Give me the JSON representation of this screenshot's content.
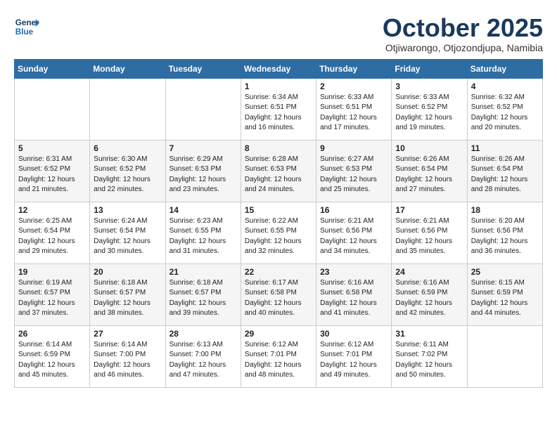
{
  "header": {
    "logo_line1": "General",
    "logo_line2": "Blue",
    "month": "October 2025",
    "location": "Otjiwarongo, Otjozondjupa, Namibia"
  },
  "weekdays": [
    "Sunday",
    "Monday",
    "Tuesday",
    "Wednesday",
    "Thursday",
    "Friday",
    "Saturday"
  ],
  "weeks": [
    [
      {
        "day": "",
        "info": ""
      },
      {
        "day": "",
        "info": ""
      },
      {
        "day": "",
        "info": ""
      },
      {
        "day": "1",
        "info": "Sunrise: 6:34 AM\nSunset: 6:51 PM\nDaylight: 12 hours\nand 16 minutes."
      },
      {
        "day": "2",
        "info": "Sunrise: 6:33 AM\nSunset: 6:51 PM\nDaylight: 12 hours\nand 17 minutes."
      },
      {
        "day": "3",
        "info": "Sunrise: 6:33 AM\nSunset: 6:52 PM\nDaylight: 12 hours\nand 19 minutes."
      },
      {
        "day": "4",
        "info": "Sunrise: 6:32 AM\nSunset: 6:52 PM\nDaylight: 12 hours\nand 20 minutes."
      }
    ],
    [
      {
        "day": "5",
        "info": "Sunrise: 6:31 AM\nSunset: 6:52 PM\nDaylight: 12 hours\nand 21 minutes."
      },
      {
        "day": "6",
        "info": "Sunrise: 6:30 AM\nSunset: 6:52 PM\nDaylight: 12 hours\nand 22 minutes."
      },
      {
        "day": "7",
        "info": "Sunrise: 6:29 AM\nSunset: 6:53 PM\nDaylight: 12 hours\nand 23 minutes."
      },
      {
        "day": "8",
        "info": "Sunrise: 6:28 AM\nSunset: 6:53 PM\nDaylight: 12 hours\nand 24 minutes."
      },
      {
        "day": "9",
        "info": "Sunrise: 6:27 AM\nSunset: 6:53 PM\nDaylight: 12 hours\nand 25 minutes."
      },
      {
        "day": "10",
        "info": "Sunrise: 6:26 AM\nSunset: 6:54 PM\nDaylight: 12 hours\nand 27 minutes."
      },
      {
        "day": "11",
        "info": "Sunrise: 6:26 AM\nSunset: 6:54 PM\nDaylight: 12 hours\nand 28 minutes."
      }
    ],
    [
      {
        "day": "12",
        "info": "Sunrise: 6:25 AM\nSunset: 6:54 PM\nDaylight: 12 hours\nand 29 minutes."
      },
      {
        "day": "13",
        "info": "Sunrise: 6:24 AM\nSunset: 6:54 PM\nDaylight: 12 hours\nand 30 minutes."
      },
      {
        "day": "14",
        "info": "Sunrise: 6:23 AM\nSunset: 6:55 PM\nDaylight: 12 hours\nand 31 minutes."
      },
      {
        "day": "15",
        "info": "Sunrise: 6:22 AM\nSunset: 6:55 PM\nDaylight: 12 hours\nand 32 minutes."
      },
      {
        "day": "16",
        "info": "Sunrise: 6:21 AM\nSunset: 6:56 PM\nDaylight: 12 hours\nand 34 minutes."
      },
      {
        "day": "17",
        "info": "Sunrise: 6:21 AM\nSunset: 6:56 PM\nDaylight: 12 hours\nand 35 minutes."
      },
      {
        "day": "18",
        "info": "Sunrise: 6:20 AM\nSunset: 6:56 PM\nDaylight: 12 hours\nand 36 minutes."
      }
    ],
    [
      {
        "day": "19",
        "info": "Sunrise: 6:19 AM\nSunset: 6:57 PM\nDaylight: 12 hours\nand 37 minutes."
      },
      {
        "day": "20",
        "info": "Sunrise: 6:18 AM\nSunset: 6:57 PM\nDaylight: 12 hours\nand 38 minutes."
      },
      {
        "day": "21",
        "info": "Sunrise: 6:18 AM\nSunset: 6:57 PM\nDaylight: 12 hours\nand 39 minutes."
      },
      {
        "day": "22",
        "info": "Sunrise: 6:17 AM\nSunset: 6:58 PM\nDaylight: 12 hours\nand 40 minutes."
      },
      {
        "day": "23",
        "info": "Sunrise: 6:16 AM\nSunset: 6:58 PM\nDaylight: 12 hours\nand 41 minutes."
      },
      {
        "day": "24",
        "info": "Sunrise: 6:16 AM\nSunset: 6:59 PM\nDaylight: 12 hours\nand 42 minutes."
      },
      {
        "day": "25",
        "info": "Sunrise: 6:15 AM\nSunset: 6:59 PM\nDaylight: 12 hours\nand 44 minutes."
      }
    ],
    [
      {
        "day": "26",
        "info": "Sunrise: 6:14 AM\nSunset: 6:59 PM\nDaylight: 12 hours\nand 45 minutes."
      },
      {
        "day": "27",
        "info": "Sunrise: 6:14 AM\nSunset: 7:00 PM\nDaylight: 12 hours\nand 46 minutes."
      },
      {
        "day": "28",
        "info": "Sunrise: 6:13 AM\nSunset: 7:00 PM\nDaylight: 12 hours\nand 47 minutes."
      },
      {
        "day": "29",
        "info": "Sunrise: 6:12 AM\nSunset: 7:01 PM\nDaylight: 12 hours\nand 48 minutes."
      },
      {
        "day": "30",
        "info": "Sunrise: 6:12 AM\nSunset: 7:01 PM\nDaylight: 12 hours\nand 49 minutes."
      },
      {
        "day": "31",
        "info": "Sunrise: 6:11 AM\nSunset: 7:02 PM\nDaylight: 12 hours\nand 50 minutes."
      },
      {
        "day": "",
        "info": ""
      }
    ]
  ]
}
